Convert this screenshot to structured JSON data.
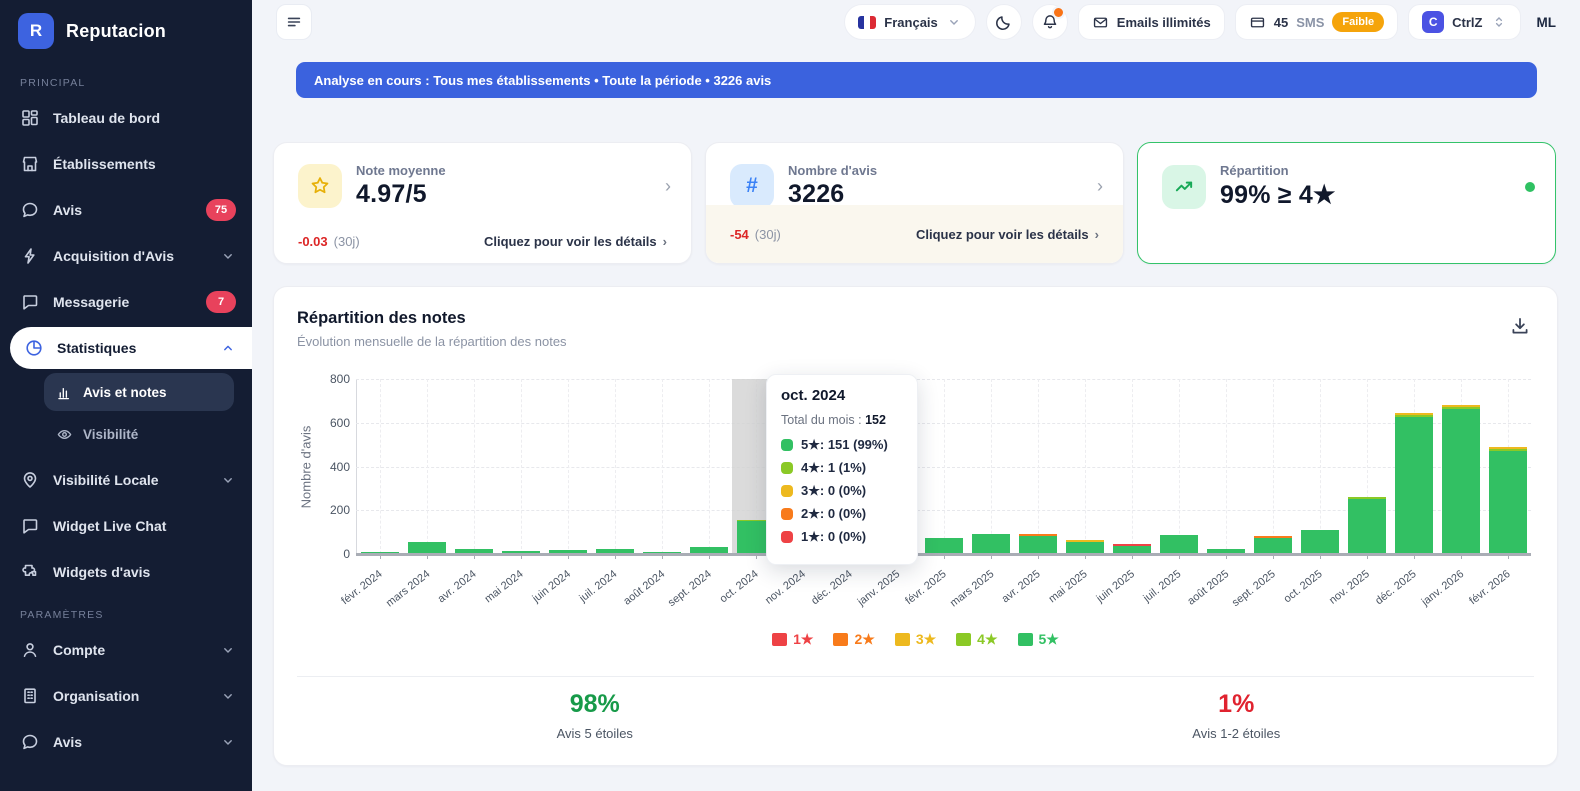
{
  "app": {
    "name": "Reputacion",
    "logo_letter": "R"
  },
  "sidebar": {
    "sections": [
      {
        "label": "PRINCIPAL",
        "items": [
          {
            "label": "Tableau de bord",
            "icon": "dashboard"
          },
          {
            "label": "Établissements",
            "icon": "store"
          },
          {
            "label": "Avis",
            "icon": "chat",
            "badge": "75"
          },
          {
            "label": "Acquisition d'Avis",
            "icon": "bolt",
            "chevron": "down"
          },
          {
            "label": "Messagerie",
            "icon": "message",
            "badge": "7"
          },
          {
            "label": "Statistiques",
            "icon": "pie",
            "chevron": "up",
            "active": true,
            "children": [
              {
                "label": "Avis et notes",
                "icon": "barchart",
                "active": true
              },
              {
                "label": "Visibilité",
                "icon": "eye"
              }
            ]
          },
          {
            "label": "Visibilité Locale",
            "icon": "pin",
            "chevron": "down"
          },
          {
            "label": "Widget Live Chat",
            "icon": "message"
          },
          {
            "label": "Widgets d'avis",
            "icon": "puzzle"
          }
        ]
      },
      {
        "label": "PARAMÈTRES",
        "items": [
          {
            "label": "Compte",
            "icon": "user",
            "chevron": "down"
          },
          {
            "label": "Organisation",
            "icon": "building",
            "chevron": "down"
          },
          {
            "label": "Avis",
            "icon": "chat",
            "chevron": "down"
          }
        ]
      }
    ]
  },
  "header": {
    "language": {
      "label": "Français"
    },
    "emails_button": "Emails illimités",
    "sms": {
      "count": "45",
      "unit": "SMS",
      "badge": "Faible"
    },
    "workspace": {
      "letter": "C",
      "label": "CtrlZ"
    },
    "user_initials": "ML"
  },
  "banner": {
    "text": "Analyse en cours : Tous mes établissements • Toute la période • 3226 avis"
  },
  "cards": [
    {
      "title": "Note moyenne",
      "value": "4.97/5",
      "delta": "-0.03",
      "period": "(30j)",
      "link": "Cliquez pour voir les détails",
      "icon": "star"
    },
    {
      "title": "Nombre d'avis",
      "value": "3226",
      "delta": "-54",
      "period": "(30j)",
      "link": "Cliquez pour voir les détails",
      "icon": "hash"
    },
    {
      "title": "Répartition",
      "value": "99% ≥ 4★",
      "icon": "trend",
      "selected": true
    }
  ],
  "chart": {
    "title": "Répartition des notes",
    "subtitle": "Évolution mensuelle de la répartition des notes"
  },
  "chart_data": {
    "type": "bar",
    "stacked": true,
    "title": "Répartition des notes",
    "ylabel": "Nombre d'avis",
    "ylim": [
      0,
      800
    ],
    "yticks": [
      0,
      200,
      400,
      600,
      800
    ],
    "grid": true,
    "legend_position": "bottom",
    "highlighted_category": "oct. 2024",
    "categories": [
      "févr. 2024",
      "mars 2024",
      "avr. 2024",
      "mai 2024",
      "juin 2024",
      "juil. 2024",
      "août 2024",
      "sept. 2024",
      "oct. 2024",
      "nov. 2024",
      "déc. 2024",
      "janv. 2025",
      "févr. 2025",
      "mars 2025",
      "avr. 2025",
      "mai 2025",
      "juin 2025",
      "juil. 2025",
      "août 2025",
      "sept. 2025",
      "oct. 2025",
      "nov. 2025",
      "déc. 2025",
      "janv. 2026",
      "févr. 2026"
    ],
    "series": [
      {
        "name": "5★",
        "color": "#32c063",
        "values": [
          3,
          55,
          22,
          14,
          18,
          22,
          7,
          30,
          151,
          35,
          50,
          58,
          75,
          90,
          83,
          55,
          37,
          88,
          25,
          75,
          108,
          251,
          626,
          664,
          470
        ]
      },
      {
        "name": "4★",
        "color": "#8bc926",
        "values": [
          0,
          0,
          0,
          0,
          0,
          0,
          0,
          0,
          1,
          0,
          0,
          0,
          0,
          0,
          0,
          0,
          0,
          0,
          0,
          0,
          0,
          4,
          5,
          5,
          5
        ]
      },
      {
        "name": "3★",
        "color": "#edb91f",
        "values": [
          0,
          0,
          0,
          0,
          0,
          0,
          0,
          0,
          0,
          0,
          0,
          0,
          0,
          0,
          0,
          3,
          0,
          0,
          0,
          0,
          0,
          0,
          4,
          3,
          3
        ]
      },
      {
        "name": "2★",
        "color": "#f87b1b",
        "values": [
          0,
          0,
          0,
          0,
          0,
          0,
          0,
          0,
          0,
          0,
          0,
          0,
          0,
          0,
          3,
          0,
          0,
          0,
          0,
          3,
          0,
          0,
          0,
          0,
          0
        ]
      },
      {
        "name": "1★",
        "color": "#ee4245",
        "values": [
          0,
          0,
          0,
          0,
          0,
          0,
          0,
          0,
          0,
          0,
          0,
          0,
          0,
          0,
          0,
          0,
          3,
          0,
          0,
          0,
          0,
          0,
          0,
          0,
          0
        ]
      }
    ]
  },
  "tooltip": {
    "title": "oct. 2024",
    "total_label": "Total du mois :",
    "total_value": "152",
    "rows": [
      {
        "label": "5★: 151 (99%)",
        "color": "#32c063"
      },
      {
        "label": "4★: 1 (1%)",
        "color": "#8bc926"
      },
      {
        "label": "3★: 0 (0%)",
        "color": "#edb91f"
      },
      {
        "label": "2★: 0 (0%)",
        "color": "#f87b1b"
      },
      {
        "label": "1★: 0 (0%)",
        "color": "#ee4245"
      }
    ]
  },
  "legend": [
    {
      "label": "1★",
      "color": "#ee4245"
    },
    {
      "label": "2★",
      "color": "#f87b1b"
    },
    {
      "label": "3★",
      "color": "#edb91f"
    },
    {
      "label": "4★",
      "color": "#8bc926"
    },
    {
      "label": "5★",
      "color": "#32c063"
    }
  ],
  "summary": {
    "left": {
      "value": "98%",
      "label": "Avis 5 étoiles",
      "color": "#179a49"
    },
    "right": {
      "value": "1%",
      "label": "Avis 1-2 étoiles",
      "color": "#e0232f"
    }
  },
  "colors": {
    "accent_blue": "#3b62de",
    "badge_red": "#e8425c",
    "selected_green": "#34c36a"
  }
}
